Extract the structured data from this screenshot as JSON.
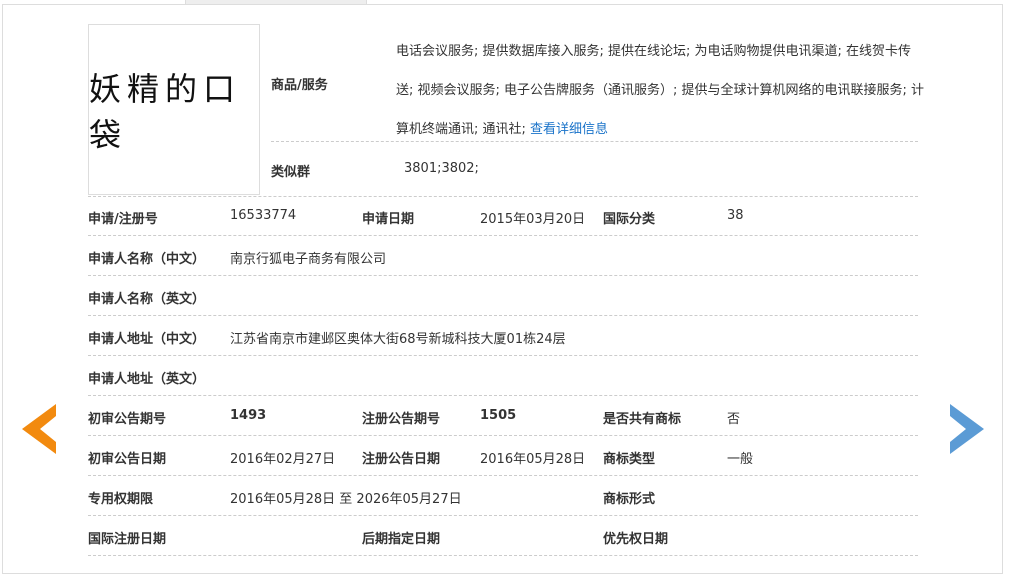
{
  "logo_text": "妖精的口袋",
  "goods": {
    "label": "商品/服务",
    "text": "电话会议服务; 提供数据库接入服务; 提供在线论坛; 为电话购物提供电讯渠道; 在线贺卡传送; 视频会议服务; 电子公告牌服务（通讯服务）; 提供与全球计算机网络的电讯联接服务; 计算机终端通讯; 通讯社; ",
    "link": "查看详细信息"
  },
  "similar": {
    "label": "类似群",
    "value": "3801;3802;"
  },
  "rows": [
    [
      {
        "l": "申请/注册号",
        "v": "16533774"
      },
      {
        "l": "申请日期",
        "v": "2015年03月20日"
      },
      {
        "l": "国际分类",
        "v": "38"
      }
    ],
    [
      {
        "l": "申请人名称（中文）",
        "v": "南京行狐电子商务有限公司"
      }
    ],
    [
      {
        "l": "申请人名称（英文）",
        "v": ""
      }
    ],
    [
      {
        "l": "申请人地址（中文）",
        "v": "江苏省南京市建邺区奥体大街68号新城科技大厦01栋24层"
      }
    ],
    [
      {
        "l": "申请人地址（英文）",
        "v": ""
      }
    ],
    [
      {
        "l": "初审公告期号",
        "v": "1493"
      },
      {
        "l": "注册公告期号",
        "v": "1505"
      },
      {
        "l": "是否共有商标",
        "v": "否"
      }
    ],
    [
      {
        "l": "初审公告日期",
        "v": "2016年02月27日"
      },
      {
        "l": "注册公告日期",
        "v": "2016年05月28日"
      },
      {
        "l": "商标类型",
        "v": "一般"
      }
    ],
    [
      {
        "l": "专用权期限",
        "v": "2016年05月28日 至 2026年05月27日"
      },
      {
        "l": "商标形式",
        "v": ""
      }
    ],
    [
      {
        "l": "国际注册日期",
        "v": ""
      },
      {
        "l": "后期指定日期",
        "v": ""
      },
      {
        "l": "优先权日期",
        "v": ""
      }
    ]
  ],
  "colors": {
    "prev_arrow": "#f28a0f",
    "next_arrow": "#5b9bd5",
    "link": "#1a73c9"
  }
}
